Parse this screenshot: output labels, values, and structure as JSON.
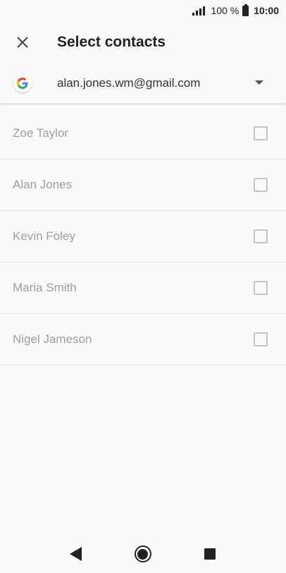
{
  "status_bar": {
    "battery_percent": "100 %",
    "time": "10:00",
    "signal_icon": "signal-icon",
    "battery_icon": "battery-icon"
  },
  "app_bar": {
    "title": "Select contacts",
    "close_icon": "close-icon"
  },
  "account": {
    "logo_icon": "google-logo-icon",
    "email": "alan.jones.wm@gmail.com",
    "dropdown_icon": "dropdown-arrow-icon"
  },
  "contacts": [
    {
      "name": "Zoe Taylor",
      "checked": false
    },
    {
      "name": "Alan Jones",
      "checked": false
    },
    {
      "name": "Kevin Foley",
      "checked": false
    },
    {
      "name": "Maria Smith",
      "checked": false
    },
    {
      "name": "Nigel Jameson",
      "checked": false
    }
  ],
  "nav_bar": {
    "back_icon": "back-icon",
    "home_icon": "home-icon",
    "recents_icon": "recents-icon"
  },
  "colors": {
    "background": "#fafafa",
    "contact_text": "#9e9e9e",
    "divider": "#e2e2e2",
    "checkbox_border": "#c4c4c4"
  }
}
